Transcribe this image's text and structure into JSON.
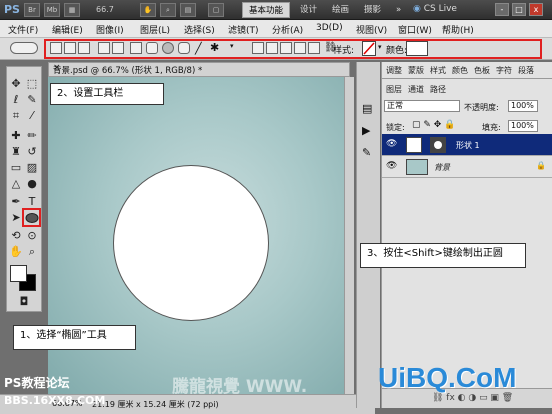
{
  "app": {
    "logo": "PS",
    "zoom": "66.7",
    "workspaces": [
      "基本功能",
      "设计",
      "绘画",
      "摄影"
    ],
    "more": "»",
    "cs_live": "CS Live",
    "win_controls": [
      "-",
      "□",
      "x"
    ]
  },
  "menu": [
    "文件(F)",
    "编辑(E)",
    "图像(I)",
    "图层(L)",
    "选择(S)",
    "滤镜(T)",
    "分析(A)",
    "3D(D)",
    "视图(V)",
    "窗口(W)",
    "帮助(H)"
  ],
  "options": {
    "style_label": "样式:",
    "color_label": "颜色:"
  },
  "document": {
    "tab_title": "背景.psd @ 66.7% (形状 1, RGB/8) *",
    "zoom": "66.67%",
    "dimensions": "21.19 厘米 x 15.24 厘米 (72 ppi)"
  },
  "panel": {
    "tabs_top": [
      "调整",
      "蒙版",
      "样式",
      "颜色",
      "色板",
      "字符",
      "段落"
    ],
    "tabs_layers": [
      "图层",
      "通道",
      "路径"
    ],
    "blend_mode": "正常",
    "opacity_label": "不透明度:",
    "opacity": "100%",
    "lock_label": "锁定:",
    "fill_label": "填充:",
    "fill": "100%",
    "layers": [
      {
        "name": "形状 1",
        "selected": true
      },
      {
        "name": "背景",
        "selected": false
      }
    ]
  },
  "annotations": {
    "step1": "1、选择“椭圆”工具",
    "step2": "2、设置工具栏",
    "step3": "3、按住<Shift>键绘制出正圆"
  },
  "watermarks": {
    "forum": "PS教程论坛",
    "bbs": "BBS.16XX8.COM",
    "center": "騰龍視覺 WWW.",
    "brand": "UiBQ.CoM"
  },
  "colors": {
    "annotation_red": "#e02020",
    "selected_layer": "#0f2a7a",
    "brand_blue": "#2a8ad8"
  }
}
